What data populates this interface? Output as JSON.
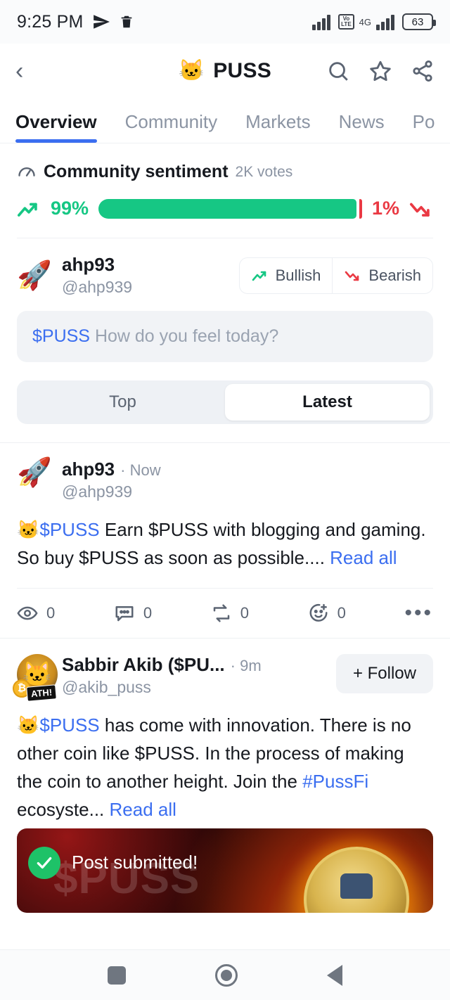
{
  "status_bar": {
    "time": "9:25 PM",
    "telegram_icon": "send-icon",
    "trash_icon": "trash-icon",
    "signal_icon": "signal-bars-icon",
    "volte_label_top": "Vo",
    "volte_label_bottom": "LTE",
    "network": "4G",
    "battery_level": "63"
  },
  "header": {
    "back_icon": "chevron-left-icon",
    "coin_logo": "🐱",
    "coin_name": "PUSS",
    "search_icon": "search-icon",
    "star_icon": "star-icon",
    "share_icon": "share-icon"
  },
  "tabs": [
    {
      "label": "Overview",
      "active": true
    },
    {
      "label": "Community",
      "active": false
    },
    {
      "label": "Markets",
      "active": false
    },
    {
      "label": "News",
      "active": false
    },
    {
      "label": "Po",
      "active": false
    }
  ],
  "sentiment": {
    "icon": "gauge-icon",
    "title": "Community sentiment",
    "votes": "2K votes",
    "bullish_pct_label": "99%",
    "bearish_pct_label": "1%",
    "bullish_pct": 99,
    "bearish_pct": 1,
    "bullish_color": "#16c784",
    "bearish_color": "#ea3943"
  },
  "composer": {
    "avatar": "🚀",
    "name": "ahp93",
    "handle": "@ahp939",
    "bullish_label": "Bullish",
    "bearish_label": "Bearish",
    "input_ticker": "$PUSS",
    "input_placeholder": "How do you feel today?"
  },
  "feed_filter": {
    "options": [
      {
        "label": "Top",
        "active": false
      },
      {
        "label": "Latest",
        "active": true
      }
    ]
  },
  "posts": [
    {
      "avatar": "🚀",
      "name": "ahp93",
      "time": "· Now",
      "handle": "@ahp939",
      "body_emoji": "🐱",
      "body_ticker": "$PUSS",
      "body_text": " Earn $PUSS with blogging and gaming. So buy $PUSS as soon as possible....",
      "read_all": "Read all",
      "actions": [
        {
          "icon": "eye-icon",
          "count": "0"
        },
        {
          "icon": "comment-icon",
          "count": "0"
        },
        {
          "icon": "repost-icon",
          "count": "0"
        },
        {
          "icon": "add-reaction-icon",
          "count": "0"
        }
      ],
      "more_label": "•••"
    },
    {
      "avatar": "🐱",
      "avatar_badge": "ATH!",
      "avatar_coin": "₿",
      "name": "Sabbir Akib ($PU...",
      "time": "· 9m",
      "handle": "@akib_puss",
      "follow_label": "+ Follow",
      "body_emoji": "🐱",
      "body_ticker": "$PUSS",
      "body_text": " has come with innovation. There is no other coin like $PUSS. In the process of making the coin to another height. Join the ",
      "body_hashtag": "#PussFi",
      "body_text_2": " ecosyste... ",
      "read_all": "Read all",
      "media_word": "$PUSS"
    }
  ],
  "toast": {
    "icon": "check-icon",
    "message": "Post submitted!",
    "color": "#1ec268"
  },
  "navigation_bar": {
    "recents_icon": "square-recents-icon",
    "home_icon": "circle-home-icon",
    "back_icon": "triangle-back-icon"
  }
}
